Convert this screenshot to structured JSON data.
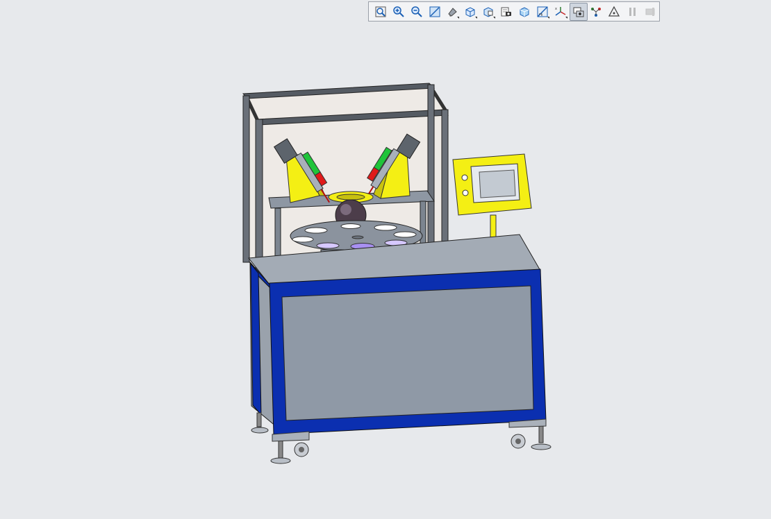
{
  "toolbar": {
    "buttons": [
      {
        "name": "zoom-to-fit-icon",
        "active": false,
        "flyout": false,
        "disabled": false
      },
      {
        "name": "zoom-in-icon",
        "active": false,
        "flyout": false,
        "disabled": false
      },
      {
        "name": "zoom-out-icon",
        "active": false,
        "flyout": false,
        "disabled": false
      },
      {
        "name": "zoom-to-area-icon",
        "active": false,
        "flyout": false,
        "disabled": false
      },
      {
        "name": "display-style-icon",
        "active": false,
        "flyout": true,
        "disabled": false
      },
      {
        "name": "view-orientation-icon",
        "active": false,
        "flyout": true,
        "disabled": false
      },
      {
        "name": "section-view-icon",
        "active": false,
        "flyout": true,
        "disabled": false
      },
      {
        "name": "camera-icon",
        "active": false,
        "flyout": false,
        "disabled": false
      },
      {
        "name": "appearance-icon",
        "active": false,
        "flyout": false,
        "disabled": false
      },
      {
        "name": "hide-show-icon",
        "active": false,
        "flyout": true,
        "disabled": false
      },
      {
        "name": "view-triad-icon",
        "active": false,
        "flyout": true,
        "disabled": false
      },
      {
        "name": "view-settings-icon",
        "active": true,
        "flyout": false,
        "disabled": false
      },
      {
        "name": "explode-icon",
        "active": false,
        "flyout": false,
        "disabled": false
      },
      {
        "name": "measure-icon",
        "active": false,
        "flyout": false,
        "disabled": false
      },
      {
        "name": "pause-icon",
        "active": false,
        "flyout": false,
        "disabled": true
      },
      {
        "name": "stop-icon",
        "active": false,
        "flyout": false,
        "disabled": true
      }
    ]
  },
  "model": {
    "description_colors": {
      "frame_blue": "#0b2fb0",
      "panel_gray": "#8f99a6",
      "accent_yellow": "#f4ef14",
      "rail_dark": "#3a3f46",
      "valve_green": "#1fc43a",
      "valve_red": "#e01a1a",
      "glass": "#efe9e4"
    }
  }
}
